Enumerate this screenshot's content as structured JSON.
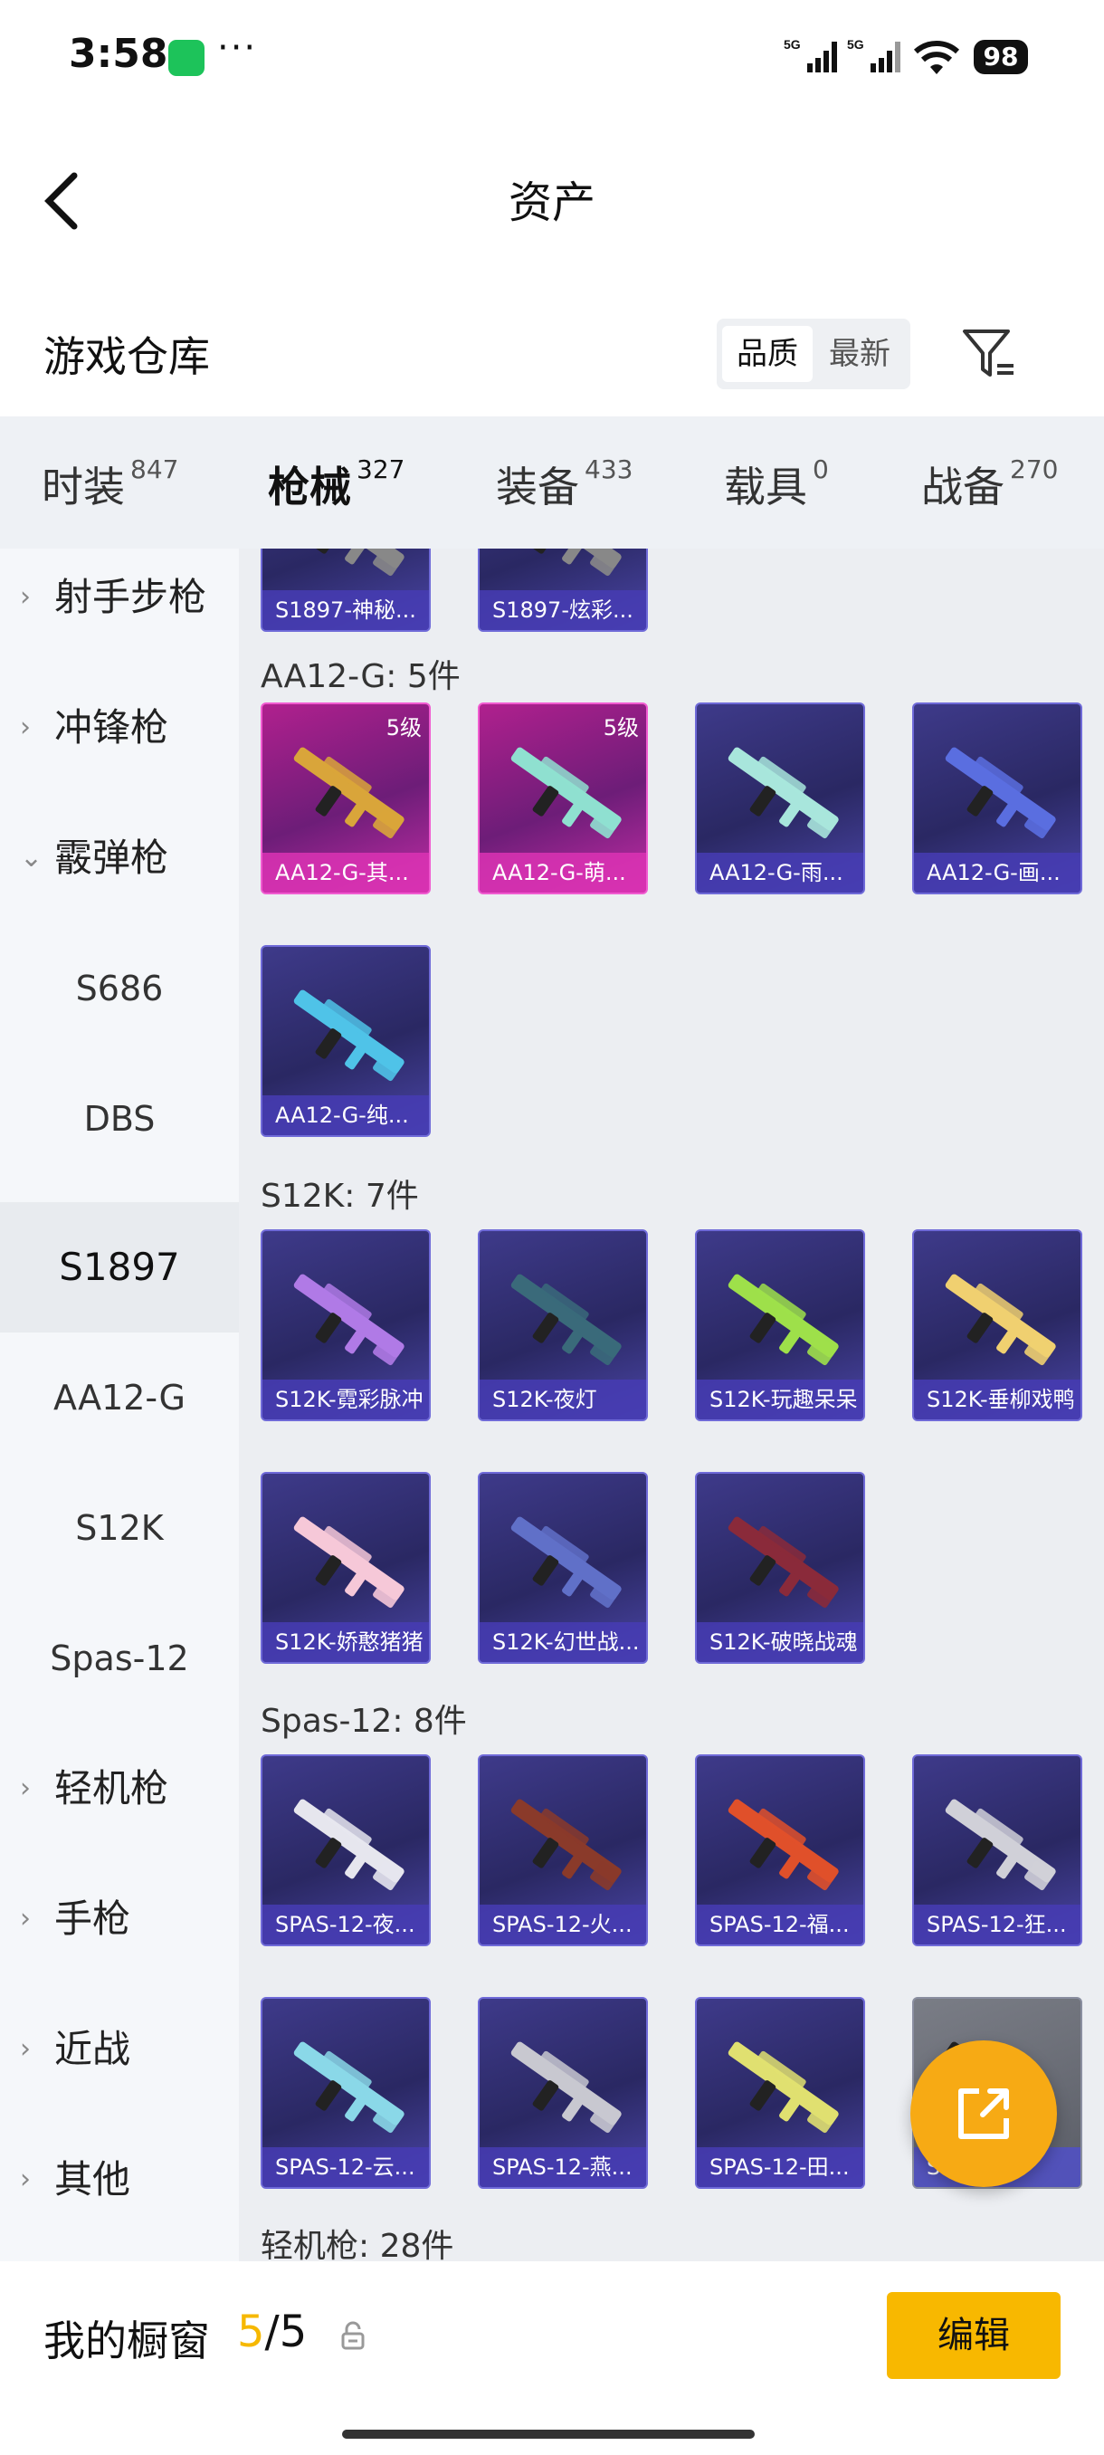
{
  "status_bar": {
    "time": "3:58",
    "dots": "···",
    "signal_1": "5G",
    "signal_2": "5G",
    "battery": "98"
  },
  "nav": {
    "title": "资产"
  },
  "warehouse": {
    "title": "游戏仓库",
    "sort_options": [
      "品质",
      "最新"
    ],
    "active_sort": "品质"
  },
  "tabs": [
    {
      "label": "时装",
      "count": "847"
    },
    {
      "label": "枪械",
      "count": "327"
    },
    {
      "label": "装备",
      "count": "433"
    },
    {
      "label": "载具",
      "count": "0"
    },
    {
      "label": "战备",
      "count": "270"
    }
  ],
  "active_tab": "枪械",
  "sidebar": [
    {
      "label": "射手步枪",
      "type": "category",
      "expanded": false
    },
    {
      "label": "冲锋枪",
      "type": "category",
      "expanded": false
    },
    {
      "label": "霰弹枪",
      "type": "category",
      "expanded": true
    },
    {
      "label": "S686",
      "type": "sub"
    },
    {
      "label": "DBS",
      "type": "sub"
    },
    {
      "label": "S1897",
      "type": "sub",
      "selected": true
    },
    {
      "label": "AA12-G",
      "type": "sub"
    },
    {
      "label": "S12K",
      "type": "sub"
    },
    {
      "label": "Spas-12",
      "type": "sub"
    },
    {
      "label": "轻机枪",
      "type": "category",
      "expanded": false
    },
    {
      "label": "手枪",
      "type": "category",
      "expanded": false
    },
    {
      "label": "近战",
      "type": "category",
      "expanded": false
    },
    {
      "label": "其他",
      "type": "category",
      "expanded": false
    }
  ],
  "content": {
    "top_partial_items": [
      "S1897-神秘...",
      "S1897-炫彩..."
    ],
    "sections": [
      {
        "heading": "AA12-G: 5件",
        "items": [
          {
            "name": "AA12-G-其...",
            "level": "5级",
            "rarity": "pink",
            "color": "#d9a53a"
          },
          {
            "name": "AA12-G-萌...",
            "level": "5级",
            "rarity": "pink",
            "color": "#8fe0d0"
          },
          {
            "name": "AA12-G-雨...",
            "rarity": "purple",
            "color": "#a8e6dc"
          },
          {
            "name": "AA12-G-画...",
            "rarity": "purple",
            "color": "#5a6ee0"
          },
          {
            "name": "AA12-G-纯...",
            "rarity": "purple",
            "color": "#4fc3e8"
          }
        ]
      },
      {
        "heading": "S12K: 7件",
        "items": [
          {
            "name": "S12K-霓彩脉冲",
            "rarity": "purple",
            "color": "#b07ae6"
          },
          {
            "name": "S12K-夜灯",
            "rarity": "purple",
            "color": "#3a6a7a"
          },
          {
            "name": "S12K-玩趣呆呆",
            "rarity": "purple",
            "color": "#9ee04a"
          },
          {
            "name": "S12K-垂柳戏鸭",
            "rarity": "purple",
            "color": "#f0d070"
          },
          {
            "name": "S12K-娇憨猪猪",
            "rarity": "purple",
            "color": "#f6c8d8"
          },
          {
            "name": "S12K-幻世战...",
            "rarity": "purple",
            "color": "#6070c8"
          },
          {
            "name": "S12K-破晓战魂",
            "rarity": "purple",
            "color": "#8a2a3a"
          }
        ]
      },
      {
        "heading": "Spas-12: 8件",
        "items": [
          {
            "name": "SPAS-12-夜...",
            "rarity": "purple",
            "color": "#e6e6ee"
          },
          {
            "name": "SPAS-12-火...",
            "rarity": "purple",
            "color": "#8a3a2a"
          },
          {
            "name": "SPAS-12-福...",
            "rarity": "purple",
            "color": "#e0502a"
          },
          {
            "name": "SPAS-12-狂...",
            "rarity": "purple",
            "color": "#d0d0d8"
          },
          {
            "name": "SPAS-12-云...",
            "rarity": "purple",
            "color": "#8ad8e8"
          },
          {
            "name": "SPAS-12-燕...",
            "rarity": "purple",
            "color": "#c8c8d0"
          },
          {
            "name": "SPAS-12-田...",
            "rarity": "purple",
            "color": "#e0e070"
          },
          {
            "name": "S...鸟...",
            "rarity": "grey",
            "color": "#222222"
          }
        ]
      },
      {
        "heading": "轻机枪: 28件",
        "items": []
      }
    ]
  },
  "showcase": {
    "label": "我的橱窗",
    "count_current": "5",
    "count_sep": "/",
    "count_total": "5"
  },
  "edit_button": "编辑",
  "colors": {
    "accent": "#f8b800",
    "fab": "#f7aa14"
  }
}
